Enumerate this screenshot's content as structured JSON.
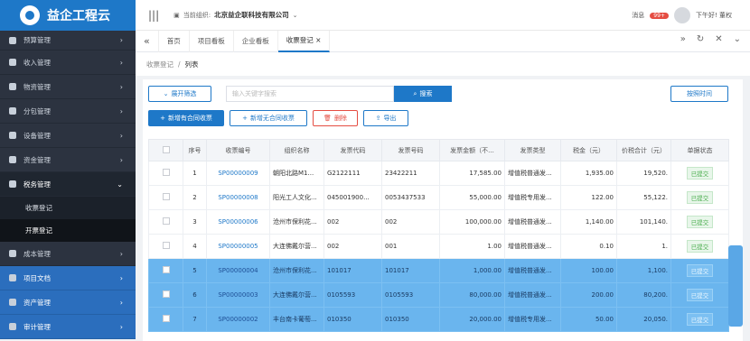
{
  "app": {
    "title": "益企工程云"
  },
  "sidebar": {
    "items": [
      {
        "label": "预算管理"
      },
      {
        "label": "收入管理"
      },
      {
        "label": "物资管理"
      },
      {
        "label": "分包管理"
      },
      {
        "label": "设备管理"
      },
      {
        "label": "资金管理"
      },
      {
        "label": "税务管理"
      },
      {
        "label": "成本管理"
      },
      {
        "label": "项目文档"
      },
      {
        "label": "资产管理"
      },
      {
        "label": "审计管理"
      }
    ],
    "submenu": [
      {
        "label": "收票登记"
      },
      {
        "label": "开票登记"
      }
    ]
  },
  "topbar": {
    "org_label": "当前组织:",
    "org_name": "北京益企联科技有限公司",
    "messages_label": "消息",
    "messages_badge": "99+",
    "greeting": "下午好! 董权"
  },
  "tabs": [
    {
      "label": "首页"
    },
    {
      "label": "项目看板"
    },
    {
      "label": "企业看板"
    },
    {
      "label": "收票登记"
    }
  ],
  "breadcrumb": {
    "parent": "收票登记",
    "current": "列表"
  },
  "toolbar": {
    "expand_filter": "展开筛选",
    "search_placeholder": "输入关键字搜索",
    "search_button": "搜索",
    "time_filter": "按照时间",
    "add_contract": "新增有合同收票",
    "add_no_contract": "新增无合同收票",
    "delete": "删除",
    "export": "导出"
  },
  "table": {
    "headers": [
      "",
      "序号",
      "收票编号",
      "组织名称",
      "发票代码",
      "发票号码",
      "发票金额（不...",
      "发票类型",
      "税金（元）",
      "价税合计（元）",
      "单据状态"
    ],
    "rows": [
      {
        "no": "1",
        "code": "SP00000009",
        "org": "朝阳北路M1...",
        "inv_code": "G2122111",
        "inv_no": "23422211",
        "amount": "17,585.00",
        "type": "增值税普通发...",
        "tax": "1,935.00",
        "total": "19,520.",
        "status": "已提交"
      },
      {
        "no": "2",
        "code": "SP00000008",
        "org": "阳光工人文化...",
        "inv_code": "045001900...",
        "inv_no": "0053437533",
        "amount": "55,000.00",
        "type": "增值税专用发...",
        "tax": "122.00",
        "total": "55,122.",
        "status": "已提交"
      },
      {
        "no": "3",
        "code": "SP00000006",
        "org": "沧州市保利花...",
        "inv_code": "002",
        "inv_no": "002",
        "amount": "100,000.00",
        "type": "增值税普通发...",
        "tax": "1,140.00",
        "total": "101,140.",
        "status": "已提交"
      },
      {
        "no": "4",
        "code": "SP00000005",
        "org": "大连佛戴尔营...",
        "inv_code": "002",
        "inv_no": "001",
        "amount": "1.00",
        "type": "增值税普通发...",
        "tax": "0.10",
        "total": "1.",
        "status": "已提交"
      },
      {
        "no": "5",
        "code": "SP00000004",
        "org": "沧州市保利花...",
        "inv_code": "101017",
        "inv_no": "101017",
        "amount": "1,000.00",
        "type": "增值税普通发...",
        "tax": "100.00",
        "total": "1,100.",
        "status": "已提交"
      },
      {
        "no": "6",
        "code": "SP00000003",
        "org": "大连佛戴尔营...",
        "inv_code": "0105593",
        "inv_no": "0105593",
        "amount": "80,000.00",
        "type": "增值税普通发...",
        "tax": "200.00",
        "total": "80,200.",
        "status": "已提交"
      },
      {
        "no": "7",
        "code": "SP00000002",
        "org": "丰台南卡葡萄...",
        "inv_code": "010350",
        "inv_no": "010350",
        "amount": "20,000.00",
        "type": "增值税专用发...",
        "tax": "50.00",
        "total": "20,050.",
        "status": "已提交"
      }
    ]
  }
}
